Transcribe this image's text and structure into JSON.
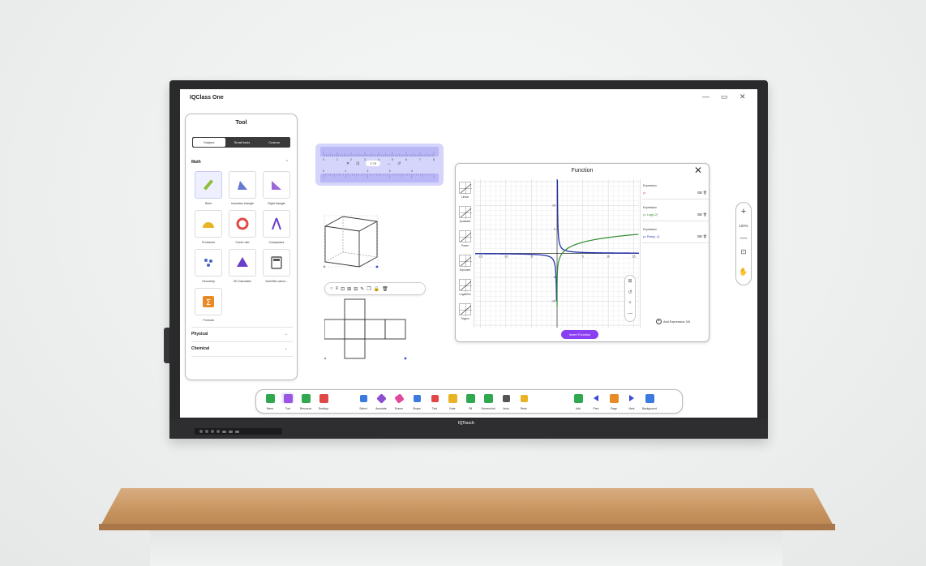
{
  "app": {
    "title": "IQClass One",
    "brand": "IQTouch"
  },
  "window": {
    "minimize": "—",
    "maximize": "▭",
    "close": "✕"
  },
  "tool_panel": {
    "title": "Tool",
    "tabs": [
      "Subject",
      "Small tools",
      "Custom"
    ],
    "sections": {
      "math": "Math",
      "physical": "Physical",
      "chemical": "Chemical"
    },
    "chevron_up": "^",
    "chevron_down": "⌄",
    "tools": [
      {
        "label": "Ruler",
        "icon": "ruler-icon",
        "color": "#8fbf3a"
      },
      {
        "label": "Isosceles triangle",
        "icon": "isosceles-triangle-icon",
        "color": "#4a64c8"
      },
      {
        "label": "Right triangle",
        "icon": "right-triangle-icon",
        "color": "#8a4fd0"
      },
      {
        "label": "Protractor",
        "icon": "protractor-icon",
        "color": "#e8b425"
      },
      {
        "label": "Circle ruler",
        "icon": "circle-ruler-icon",
        "color": "#e24a4a"
      },
      {
        "label": "Compasses",
        "icon": "compasses-icon",
        "color": "#6a3fc8"
      },
      {
        "label": "Geometry",
        "icon": "geometry-icon",
        "color": "#4a64c8"
      },
      {
        "label": "3D Calculator",
        "icon": "3d-calculator-icon",
        "color": "#6a3fc8"
      },
      {
        "label": "Scientific calcul...",
        "icon": "scientific-calculator-icon",
        "color": "#555555"
      },
      {
        "label": "Formula",
        "icon": "formula-icon",
        "color": "#e88a25"
      }
    ]
  },
  "ruler": {
    "top_numbers": [
      "0",
      "1",
      "2",
      "3",
      "4",
      "5",
      "6",
      "7",
      "8"
    ],
    "bottom_numbers": [
      "0",
      "1",
      "2",
      "3",
      "4"
    ],
    "value": "2.76",
    "controls": [
      "✕",
      "⊡",
      "↔",
      "↺"
    ]
  },
  "mini_toolbar": {
    "icons": [
      "○",
      "≡",
      "⊡",
      "⊞",
      "⊟",
      "✎",
      "❐",
      "🔒",
      "🗑"
    ]
  },
  "function_dialog": {
    "title": "Function",
    "close": "✕",
    "types": [
      "Linear",
      "Quadratic",
      "Power",
      "Exponent",
      "Logarithm",
      "Trigono"
    ],
    "axis_labels": {
      "x": [
        "-15",
        "-10",
        "-5",
        "5",
        "10",
        "15"
      ],
      "y": [
        "10",
        "5",
        "-5",
        "-10"
      ]
    },
    "expressions": [
      {
        "caption": "Expression",
        "value": "y=",
        "color": "#d23a3a"
      },
      {
        "caption": "Expression",
        "value": "y= Log(x,2)",
        "color": "#2e8b2e"
      },
      {
        "caption": "Expression",
        "value": "y= Pow(x,-1)",
        "color": "#1f2fb0"
      }
    ],
    "expr_icons": "⌨  🗑",
    "add_expression": "Add Expression 3/6",
    "add_icon": "+",
    "insert_button": "Insert Function",
    "zoom_controls": [
      "⊞",
      "↺",
      "+",
      "—"
    ]
  },
  "zoom_pill": {
    "plus": "+",
    "percent": "100%",
    "minus": "—",
    "fit": "⊡",
    "hand": "✋"
  },
  "bottom_bar": [
    {
      "label": "Menu",
      "icon": "menu-icon",
      "color": "#2fa84f"
    },
    {
      "label": "Tool",
      "icon": "toolbox-icon",
      "color": "#9a56e0"
    },
    {
      "label": "Resource",
      "icon": "resource-icon",
      "color": "#2fa84f"
    },
    {
      "label": "Desktop",
      "icon": "desktop-icon",
      "color": "#e04848"
    },
    {
      "label": "Select",
      "icon": "select-icon",
      "color": "#3b7ae0"
    },
    {
      "label": "Annotate",
      "icon": "annotate-icon",
      "color": "#8a4fd0"
    },
    {
      "label": "Eraser",
      "icon": "eraser-icon",
      "color": "#e0489a"
    },
    {
      "label": "Shape",
      "icon": "shape-icon",
      "color": "#3b7ae0"
    },
    {
      "label": "Text",
      "icon": "text-icon",
      "color": "#e04848"
    },
    {
      "label": "Note",
      "icon": "note-icon",
      "color": "#e8b425"
    },
    {
      "label": "Fill",
      "icon": "fill-icon",
      "color": "#2fa84f"
    },
    {
      "label": "Screenshot",
      "icon": "screenshot-icon",
      "color": "#2fa84f"
    },
    {
      "label": "Undo",
      "icon": "undo-icon",
      "color": "#555555"
    },
    {
      "label": "Redo",
      "icon": "redo-icon",
      "color": "#e8b425"
    },
    {
      "label": "Add",
      "icon": "add-page-icon",
      "color": "#2fa84f"
    },
    {
      "label": "Prev",
      "icon": "prev-icon",
      "color": "#3b4ad0"
    },
    {
      "label": "Page",
      "icon": "page-icon",
      "color": "#e88a25"
    },
    {
      "label": "Next",
      "icon": "next-icon",
      "color": "#3b4ad0"
    },
    {
      "label": "Background",
      "icon": "background-icon",
      "color": "#3b7ae0"
    }
  ]
}
